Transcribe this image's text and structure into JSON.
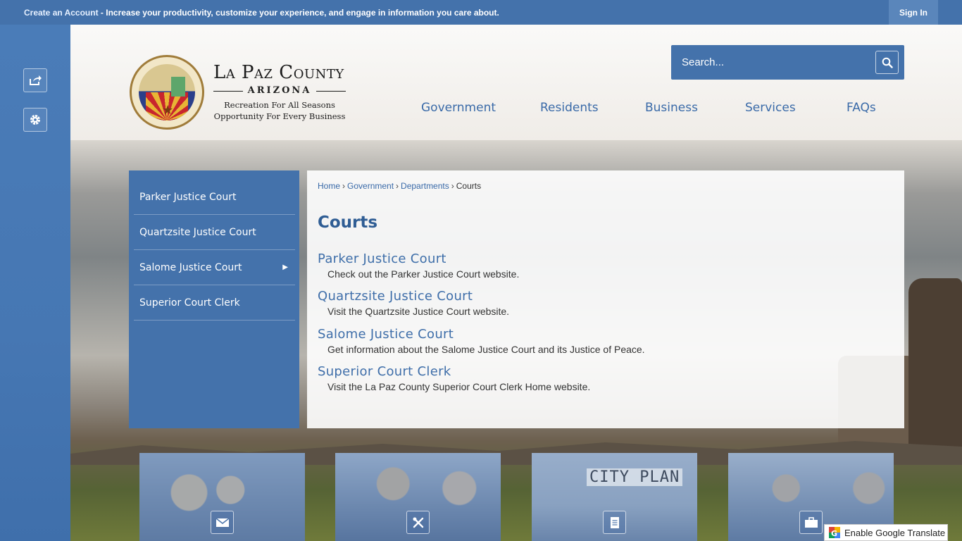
{
  "topbar": {
    "create_link": "Create an Account",
    "message": " - Increase your productivity, customize your experience, and engage in information you care about.",
    "signin_label": "Sign In"
  },
  "logo": {
    "title": "La Paz County",
    "state": "ARIZONA",
    "tagline1": "Recreation For All Seasons",
    "tagline2": "Opportunity For Every Business"
  },
  "search": {
    "placeholder": "Search..."
  },
  "nav": {
    "items": [
      {
        "label": "Government"
      },
      {
        "label": "Residents"
      },
      {
        "label": "Business"
      },
      {
        "label": "Services"
      },
      {
        "label": "FAQs"
      }
    ]
  },
  "sidenav": {
    "items": [
      {
        "label": "Parker Justice Court"
      },
      {
        "label": "Quartzsite Justice Court"
      },
      {
        "label": "Salome Justice Court",
        "arrow": "▶"
      },
      {
        "label": "Superior Court Clerk"
      }
    ]
  },
  "breadcrumb": {
    "items": [
      "Home",
      "Government",
      "Departments"
    ],
    "separator": "›",
    "current": "Courts"
  },
  "page": {
    "title": "Courts",
    "entries": [
      {
        "title": "Parker Justice Court",
        "desc": "Check out the Parker Justice Court website."
      },
      {
        "title": "Quartzsite Justice Court",
        "desc": "Visit the Quartzsite Justice Court website."
      },
      {
        "title": "Salome Justice Court",
        "desc": "Get information about the Salome Justice Court and its Justice of Peace."
      },
      {
        "title": "Superior Court Clerk",
        "desc": "Visit the La Paz County Superior Court Clerk Home website."
      }
    ]
  },
  "tiles": {
    "sign_text": "CITY PLAN",
    "icons": [
      "envelope-icon",
      "utensils-icon",
      "document-icon",
      "briefcase-icon"
    ]
  },
  "translate": {
    "label": "Enable Google Translate"
  },
  "colors": {
    "brand_blue": "#4472ab",
    "link_blue": "#3e6ea9"
  }
}
